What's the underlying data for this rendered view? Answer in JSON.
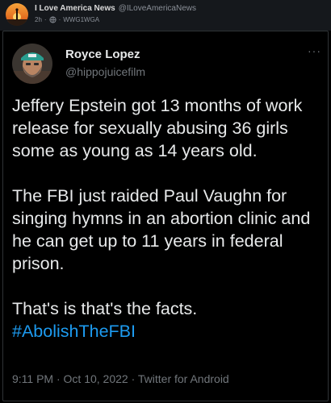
{
  "repost_header": {
    "account_name": "I Love America News",
    "account_handle": "@ILoveAmericaNews",
    "time_ago": "2h",
    "separator": "·",
    "source_tag": "WWG1WGA"
  },
  "tweet": {
    "author_name": "Royce Lopez",
    "author_handle": "@hippojuicefilm",
    "more_label": "···",
    "paragraphs": {
      "p1": "Jeffery Epstein got 13 months of work release for sexually abusing 36 girls some as young as 14 years old.",
      "p2": "The FBI just raided Paul Vaughn for singing hymns in an abortion clinic and he can get up to 11 years in federal prison.",
      "p3": "That's is that's the facts.",
      "hashtag": "#AbolishTheFBI"
    },
    "timestamp": "9:11 PM · Oct 10, 2022 · Twitter for Android"
  },
  "colors": {
    "background": "#000000",
    "text": "#e7e9ea",
    "secondary_text": "#71767b",
    "link": "#1d9bf0",
    "header_bar": "#15181c"
  },
  "icons": {
    "outer_avatar": "sunset-figure-avatar-icon",
    "author_avatar": "bearded-man-cap-avatar-icon",
    "visibility": "globe-icon",
    "more": "more-options-icon"
  }
}
